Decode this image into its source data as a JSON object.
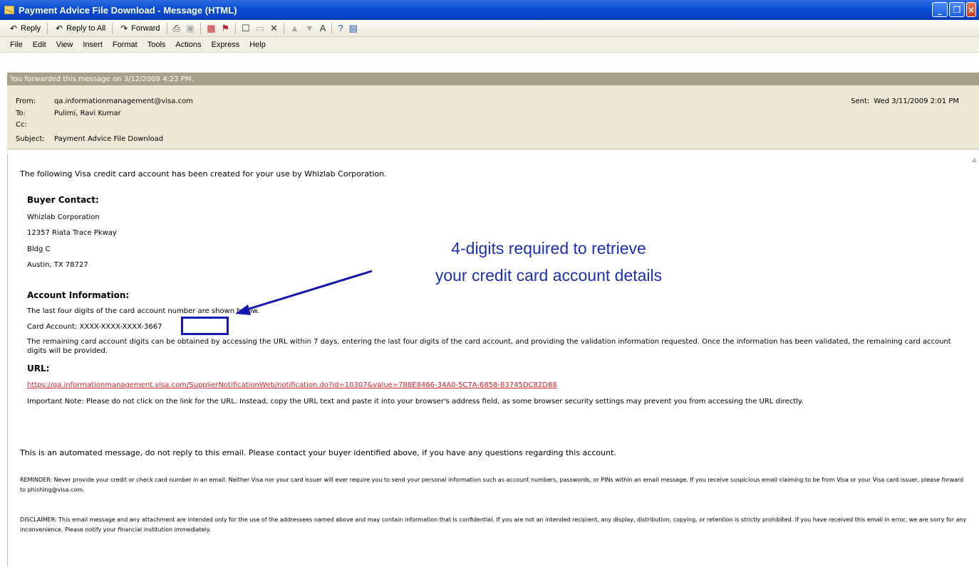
{
  "window": {
    "title": "Payment Advice File Download - Message (HTML)"
  },
  "toolbar": {
    "reply": "Reply",
    "reply_all": "Reply to All",
    "forward": "Forward"
  },
  "menu": [
    "File",
    "Edit",
    "View",
    "Insert",
    "Format",
    "Tools",
    "Actions",
    "Express",
    "Help"
  ],
  "infobar": "You forwarded this message on 3/12/2009 4:23 PM.",
  "header": {
    "from_label": "From:",
    "from": "qa.informationmanagement@visa.com",
    "to_label": "To:",
    "to": "Pulimi, Ravi Kumar",
    "cc_label": "Cc:",
    "cc": "",
    "subject_label": "Subject:",
    "subject": "Payment Advice File Download",
    "sent_label": "Sent:",
    "sent": "Wed 3/11/2009 2:01 PM"
  },
  "body": {
    "intro": "The following Visa credit card account has been created for your use by Whizlab Corporation.",
    "buyer_heading": "Buyer Contact:",
    "address": [
      "Whizlab Corporation",
      "12357 Riata Trace Pkway",
      "Bldg C",
      "Austin, TX 78727"
    ],
    "account_heading": "Account Information:",
    "last_four_text": "The last four digits of the card account number are shown below.",
    "card_account_label": "Card Account: XXXX-XXXX-XXXX-",
    "card_last_four": "3667",
    "remaining_text": "The remaining card account digits can be obtained by accessing the URL within 7 days, entering the last four digits of the card account, and providing the validation information requested. Once the information has been validated, the remaining card account digits will be provided.",
    "url_heading": "URL:",
    "url": "https://qa.informationmanagement.visa.com/SupplierNotificationWeb/notification.do?id=10307&value=788E8466-34A0-5C7A-6858-83745DC82D88",
    "important_note": "Important Note: Please do not click on the link for the URL. Instead, copy the URL text and paste it into your browser's address field, as some browser security settings may prevent you from accessing the URL directly.",
    "automated": "This is an automated message, do not reply to this email. Please contact your buyer identified above, if you have any questions regarding this account.",
    "reminder": "REMINDER: Never provide your credit or check card number in an email. Neither Visa nor your card issuer will ever require you to send your personal information such as account numbers, passwords, or PINs within an email message. If you receive suspicious email claiming to be from Visa or your Visa card issuer, please forward to phishing@visa.com.",
    "disclaimer": "DISCLAIMER: This email message and any attachment are intended only for the use of the addressees named above and may contain information that is confidential. If you are not an intended recipient, any display, distribution, copying, or retention is strictly prohibited. If you have received this email in error, we are sorry for any inconvenience. Please notify your financial institution immediately."
  },
  "annotation": {
    "line1": "4-digits required to retrieve",
    "line2": "your credit card account details"
  },
  "colors": {
    "link": "#d8232a",
    "annotation": "#1a2fb8"
  }
}
